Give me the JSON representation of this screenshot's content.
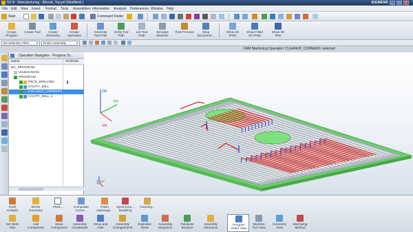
{
  "window": {
    "title": "NX 8 - Manufacturing - [Mould_Top.prt (Modified) ]",
    "brand": "SIEMENS",
    "controls": [
      "_",
      "□",
      "×"
    ]
  },
  "menubar": {
    "items": [
      "File",
      "Edit",
      "View",
      "Insert",
      "Format",
      "Tools",
      "Assemblies",
      "Information",
      "Analysis",
      "Preferences",
      "Window",
      "Help"
    ]
  },
  "toolbar": {
    "start_label": "Start",
    "command_finder_label": "Command Finder"
  },
  "ribbon": {
    "buttons": [
      {
        "label": "Create\nProgram",
        "icon": "create-program-icon"
      },
      {
        "label": "Create Tool",
        "icon": "create-tool-icon"
      },
      {
        "label": "Create\nGeometry",
        "icon": "create-geometry-icon"
      },
      {
        "label": "Create\nOperation",
        "icon": "create-operation-icon"
      },
      {
        "label": "Generate\nTool Path",
        "icon": "generate-tool-path-icon"
      },
      {
        "label": "Verify Tool\nPath",
        "icon": "verify-tool-path-icon"
      },
      {
        "label": "List Tool\nPath",
        "icon": "list-tool-path-icon"
      },
      {
        "label": "Simulate\nMachine",
        "icon": "simulate-machine-icon"
      },
      {
        "label": "Post Process",
        "icon": "post-process-icon"
      },
      {
        "label": "Shop\nDocument...",
        "icon": "shop-document-icon"
      },
      {
        "label": "Show 2D\nIPWs",
        "icon": "show-2d-ipw-icon"
      },
      {
        "label": "Show Filled\n2D IPWs",
        "icon": "show-filled-2d-ipw-icon"
      },
      {
        "label": "Show 3D\nIPW",
        "icon": "show-3d-ipw-icon"
      }
    ]
  },
  "filterbar": {
    "selection_filter": "No Selection Filter",
    "scope": "Entire Assembly"
  },
  "status_message": "CAM Machining Operation 'CLEANUP_CORNERS' selected",
  "navigator": {
    "title": "Operation Navigator - Program Or...",
    "columns": [
      "Name",
      "Toolchan"
    ],
    "rows": [
      {
        "name": "NC_PROGRAM",
        "indent": 0,
        "check": "none",
        "selected": false
      },
      {
        "name": "Unused Items",
        "indent": 1,
        "check": "none",
        "selected": false
      },
      {
        "name": "PROGRAM",
        "indent": 1,
        "check": "green",
        "selected": false
      },
      {
        "name": "PECK_DRILLING",
        "indent": 2,
        "check": "green",
        "selected": false
      },
      {
        "name": "CAVITY_MILL",
        "indent": 2,
        "check": "green",
        "selected": false
      },
      {
        "name": "CLEANUP_CORNERS",
        "indent": 2,
        "check": "green",
        "selected": true
      },
      {
        "name": "CAVITY_MILL_1",
        "indent": 2,
        "check": "green",
        "selected": false
      }
    ]
  },
  "viewport": {
    "axes": {
      "x": "XM",
      "y": "YM",
      "z": "ZM"
    },
    "colors": {
      "plate_top": "#b4bcc4",
      "plate_rim": "#7fe07f",
      "toolpath_red": "#e0241f",
      "toolpath_blue": "#2546c9",
      "toolpath_white": "#f4f6f8"
    }
  },
  "bottombar": {
    "row1": [
      {
        "label": "Draft\nAnalysis",
        "icon": "draft-analysis-icon"
      },
      {
        "label": "WAVE\nGeometry",
        "icon": "wave-geometry-icon"
      },
      {
        "label": "Point...",
        "icon": "point-icon"
      },
      {
        "label": "Composite\nCurve...",
        "icon": "composite-curve-icon"
      },
      {
        "label": "Patch\nOpenings...",
        "icon": "patch-openings-icon"
      },
      {
        "label": "Synchrono...\nModeling",
        "icon": "synchronous-modeling-icon"
      },
      {
        "label": "Faceting...",
        "icon": "faceting-icon"
      }
    ],
    "row2": [
      {
        "label": "Set Work\nPart",
        "icon": "set-work-part-icon",
        "active": false
      },
      {
        "label": "Add\nComponent",
        "icon": "add-component-icon",
        "active": false
      },
      {
        "label": "Move\nComponent",
        "icon": "move-component-icon",
        "active": false
      },
      {
        "label": "Assembly\nConstraints",
        "icon": "assembly-constraints-icon",
        "active": false
      },
      {
        "label": "Show and\nHide",
        "icon": "show-and-hide-icon",
        "active": false
      },
      {
        "label": "Assembly\nArrangements",
        "icon": "assembly-arrangements-icon",
        "active": false
      },
      {
        "label": "Exploded\nViews",
        "icon": "exploded-views-icon",
        "active": false
      },
      {
        "label": "Assembly\nSequence",
        "icon": "assembly-sequence-icon",
        "active": false
      },
      {
        "label": "Relations\nBrowser",
        "icon": "relations-browser-icon",
        "active": false
      },
      {
        "label": "Assembly\nClearance",
        "icon": "assembly-clearance-icon",
        "active": false
      },
      {
        "label": "Program\nOrder View",
        "icon": "program-order-view-icon",
        "active": true
      },
      {
        "label": "Machine\nTool View",
        "icon": "machine-tool-view-icon",
        "active": false
      },
      {
        "label": "Geometry\nView",
        "icon": "geometry-view-icon",
        "active": false
      },
      {
        "label": "Machining\nMethod",
        "icon": "machining-method-icon",
        "active": false
      }
    ]
  }
}
